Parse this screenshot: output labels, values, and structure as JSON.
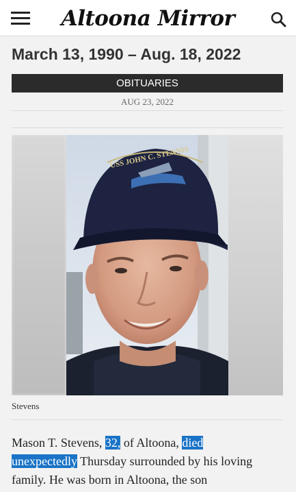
{
  "header": {
    "logo_text": "Altoona Mirror",
    "menu_icon": "hamburger-menu-icon",
    "search_icon": "search-icon"
  },
  "article": {
    "headline": "March 13, 1990 – Aug. 18, 2022",
    "section": "OBITUARIES",
    "date": "AUG 23, 2022",
    "photo_caption": "Stevens",
    "hat_text": "USS JOHN C. STENNIS",
    "body": {
      "part1": "Mason T. Stevens, ",
      "highlight1": "32,",
      "part2": " of Altoona, ",
      "highlight2a": "died",
      "highlight2b": "unexpectedly",
      "part3": " Thursday surrounded by his loving family. He was born in Altoona, the son"
    }
  },
  "colors": {
    "highlight": "#1a73c6",
    "section_bar": "#2b2b2b"
  }
}
